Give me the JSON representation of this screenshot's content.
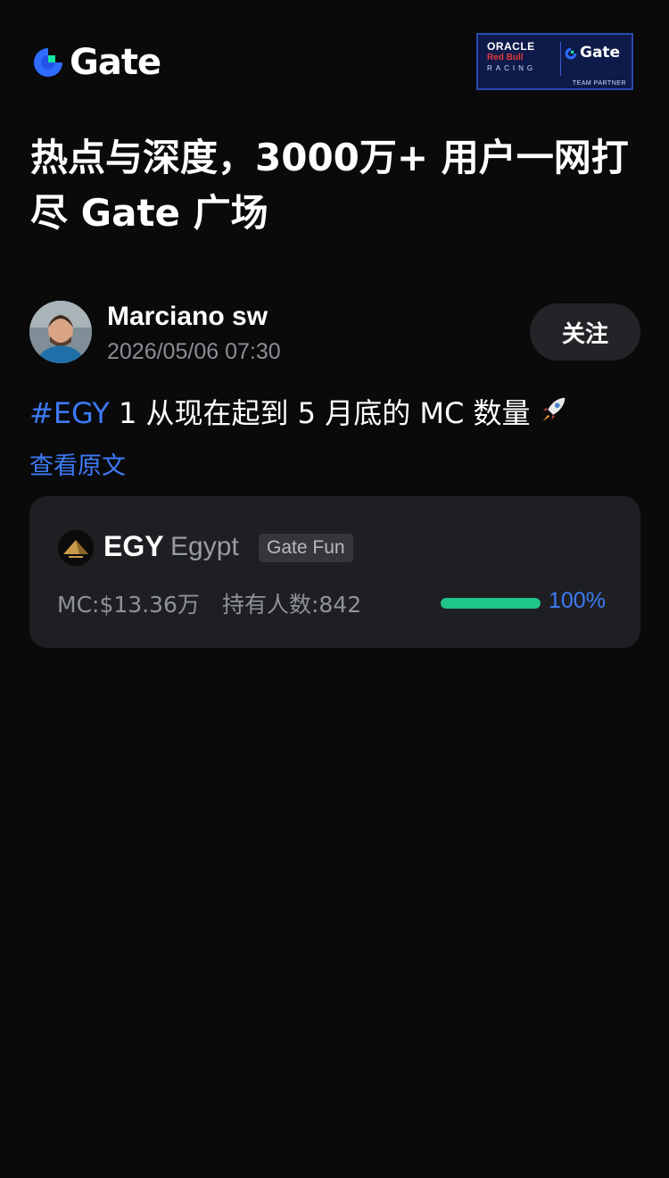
{
  "header": {
    "logo_text": "Gate",
    "partner_badge": {
      "oracle": "ORACLE",
      "redbull": "Red Bull",
      "racing": "RACING",
      "gate": "Gate",
      "team_partner": "TEAM PARTNER"
    }
  },
  "headline": "热点与深度，3000万+ 用户一网打尽 Gate 广场",
  "post": {
    "author": "Marciano sw",
    "time": "2026/05/06 07:30",
    "follow_label": "关注",
    "hashtag": "#EGY",
    "text": " 1 从现在起到 5 月底的 MC 数量",
    "view_original": "查看原文"
  },
  "token_card": {
    "symbol": "EGY",
    "name": "Egypt",
    "tag": "Gate Fun",
    "mc": "MC:$13.36万",
    "holders": "持有人数:842",
    "progress_label": "100%",
    "progress_fraction": 1.0
  },
  "colors": {
    "background": "#0a0a0b",
    "accent_blue": "#3d7af5",
    "progress_green": "#1fc68a",
    "card_bg": "#1e1f23"
  }
}
